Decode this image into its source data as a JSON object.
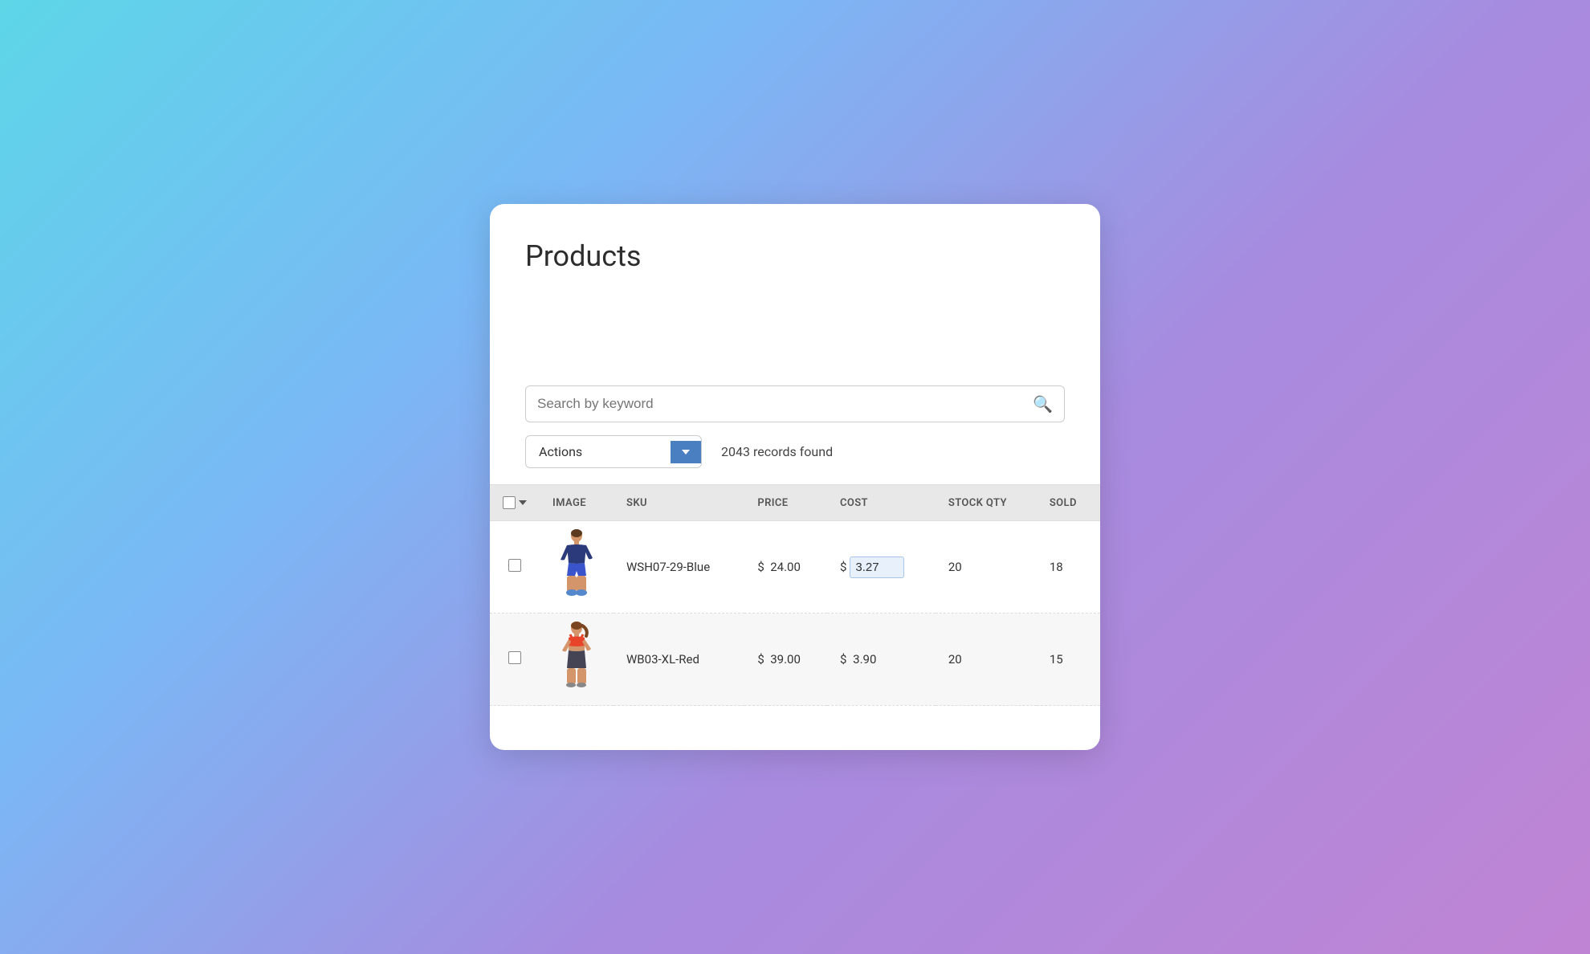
{
  "page": {
    "title": "Products"
  },
  "search": {
    "placeholder": "Search by keyword"
  },
  "toolbar": {
    "actions_label": "Actions",
    "records_found": "2043 records found"
  },
  "table": {
    "columns": [
      {
        "key": "select",
        "label": ""
      },
      {
        "key": "image",
        "label": "IMAGE"
      },
      {
        "key": "sku",
        "label": "SKU"
      },
      {
        "key": "price",
        "label": "PRICE"
      },
      {
        "key": "cost",
        "label": "COST"
      },
      {
        "key": "stock_qty",
        "label": "STOCK QTY"
      },
      {
        "key": "sold",
        "label": "SOLD"
      }
    ],
    "rows": [
      {
        "sku": "WSH07-29-Blue",
        "price": "$ 24.00",
        "cost_prefix": "$",
        "cost_value": "3.27",
        "stock_qty": "20",
        "sold": "18",
        "figure": "shorts"
      },
      {
        "sku": "WB03-XL-Red",
        "price": "$ 39.00",
        "cost_prefix": "$",
        "cost_value": "3.90",
        "stock_qty": "20",
        "sold": "15",
        "figure": "bra"
      }
    ]
  }
}
